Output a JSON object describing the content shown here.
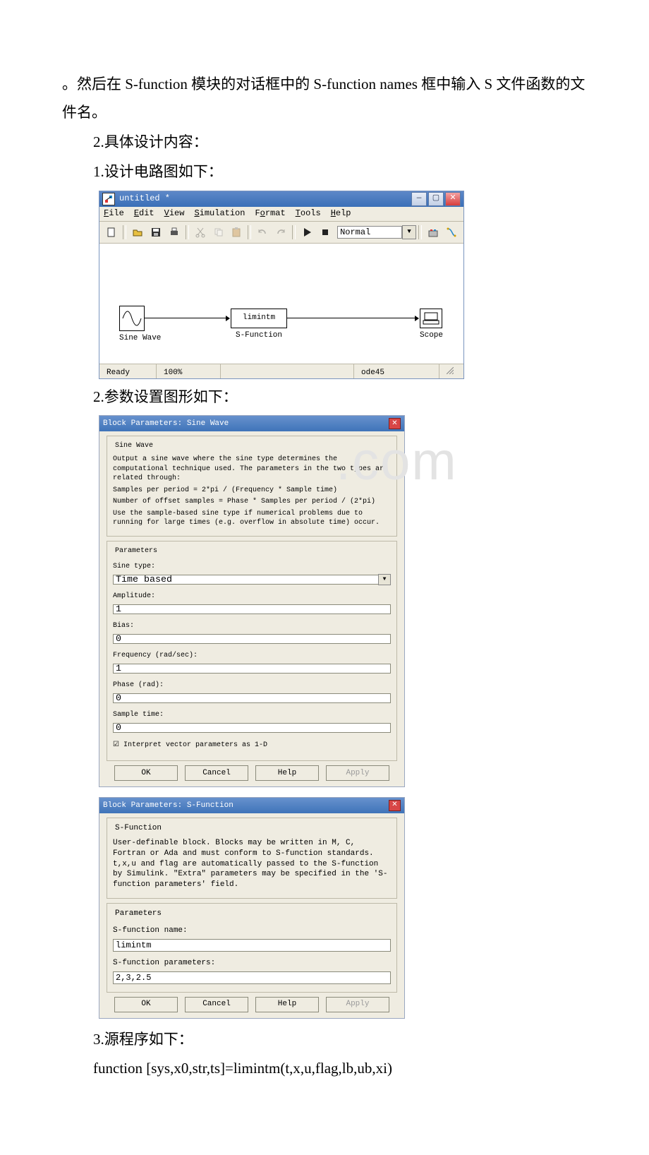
{
  "text": {
    "p1": "。然后在 S-function 模块的对话框中的 S-function names 框中输入 S 文件函数的文件名。",
    "p2": "2.具体设计内容：",
    "p3": "1.设计电路图如下：",
    "p4": "2.参数设置图形如下：",
    "p5": "3.源程序如下：",
    "p6": "function [sys,x0,str,ts]=limintm(t,x,u,flag,lb,ub,xi)"
  },
  "watermark": ".com",
  "simwin": {
    "title": "untitled *",
    "menus": {
      "file": "File",
      "edit": "Edit",
      "view": "View",
      "simulation": "Simulation",
      "format": "Format",
      "tools": "Tools",
      "help": "Help"
    },
    "mode": "Normal",
    "blocks": {
      "sine": "Sine Wave",
      "sfun_label": "S-Function",
      "sfun_name": "limintm",
      "scope": "Scope"
    },
    "status": {
      "ready": "Ready",
      "zoom": "100%",
      "solver": "ode45"
    }
  },
  "sine_dlg": {
    "title": "Block Parameters: Sine Wave",
    "group": "Sine Wave",
    "desc1": "Output a sine wave where the sine type determines the computational technique used. The parameters in the two types are related through:",
    "desc2": "Samples per period = 2*pi / (Frequency * Sample time)",
    "desc3": "Number of offset samples = Phase * Samples per period / (2*pi)",
    "desc4": "Use the sample-based sine type if numerical problems due to running for large times (e.g. overflow in absolute time) occur.",
    "params_legend": "Parameters",
    "sine_type_lbl": "Sine type:",
    "sine_type_val": "Time based",
    "amp_lbl": "Amplitude:",
    "amp_val": "1",
    "bias_lbl": "Bias:",
    "bias_val": "0",
    "freq_lbl": "Frequency (rad/sec):",
    "freq_val": "1",
    "phase_lbl": "Phase (rad):",
    "phase_val": "0",
    "st_lbl": "Sample time:",
    "st_val": "0",
    "chk": "Interpret vector parameters as 1-D"
  },
  "sfun_dlg": {
    "title": "Block Parameters: S-Function",
    "group": "S-Function",
    "desc": "User-definable block.  Blocks may be written in M, C, Fortran or Ada and must  conform to S-function standards. t,x,u and flag are automatically passed to the S-function by Simulink.  \"Extra\" parameters may be specified in the 'S-function parameters' field.",
    "params_legend": "Parameters",
    "name_lbl": "S-function name:",
    "name_val": "limintm",
    "params_lbl": "S-function parameters:",
    "params_val": "2,3,2.5"
  },
  "buttons": {
    "ok": "OK",
    "cancel": "Cancel",
    "help": "Help",
    "apply": "Apply"
  }
}
